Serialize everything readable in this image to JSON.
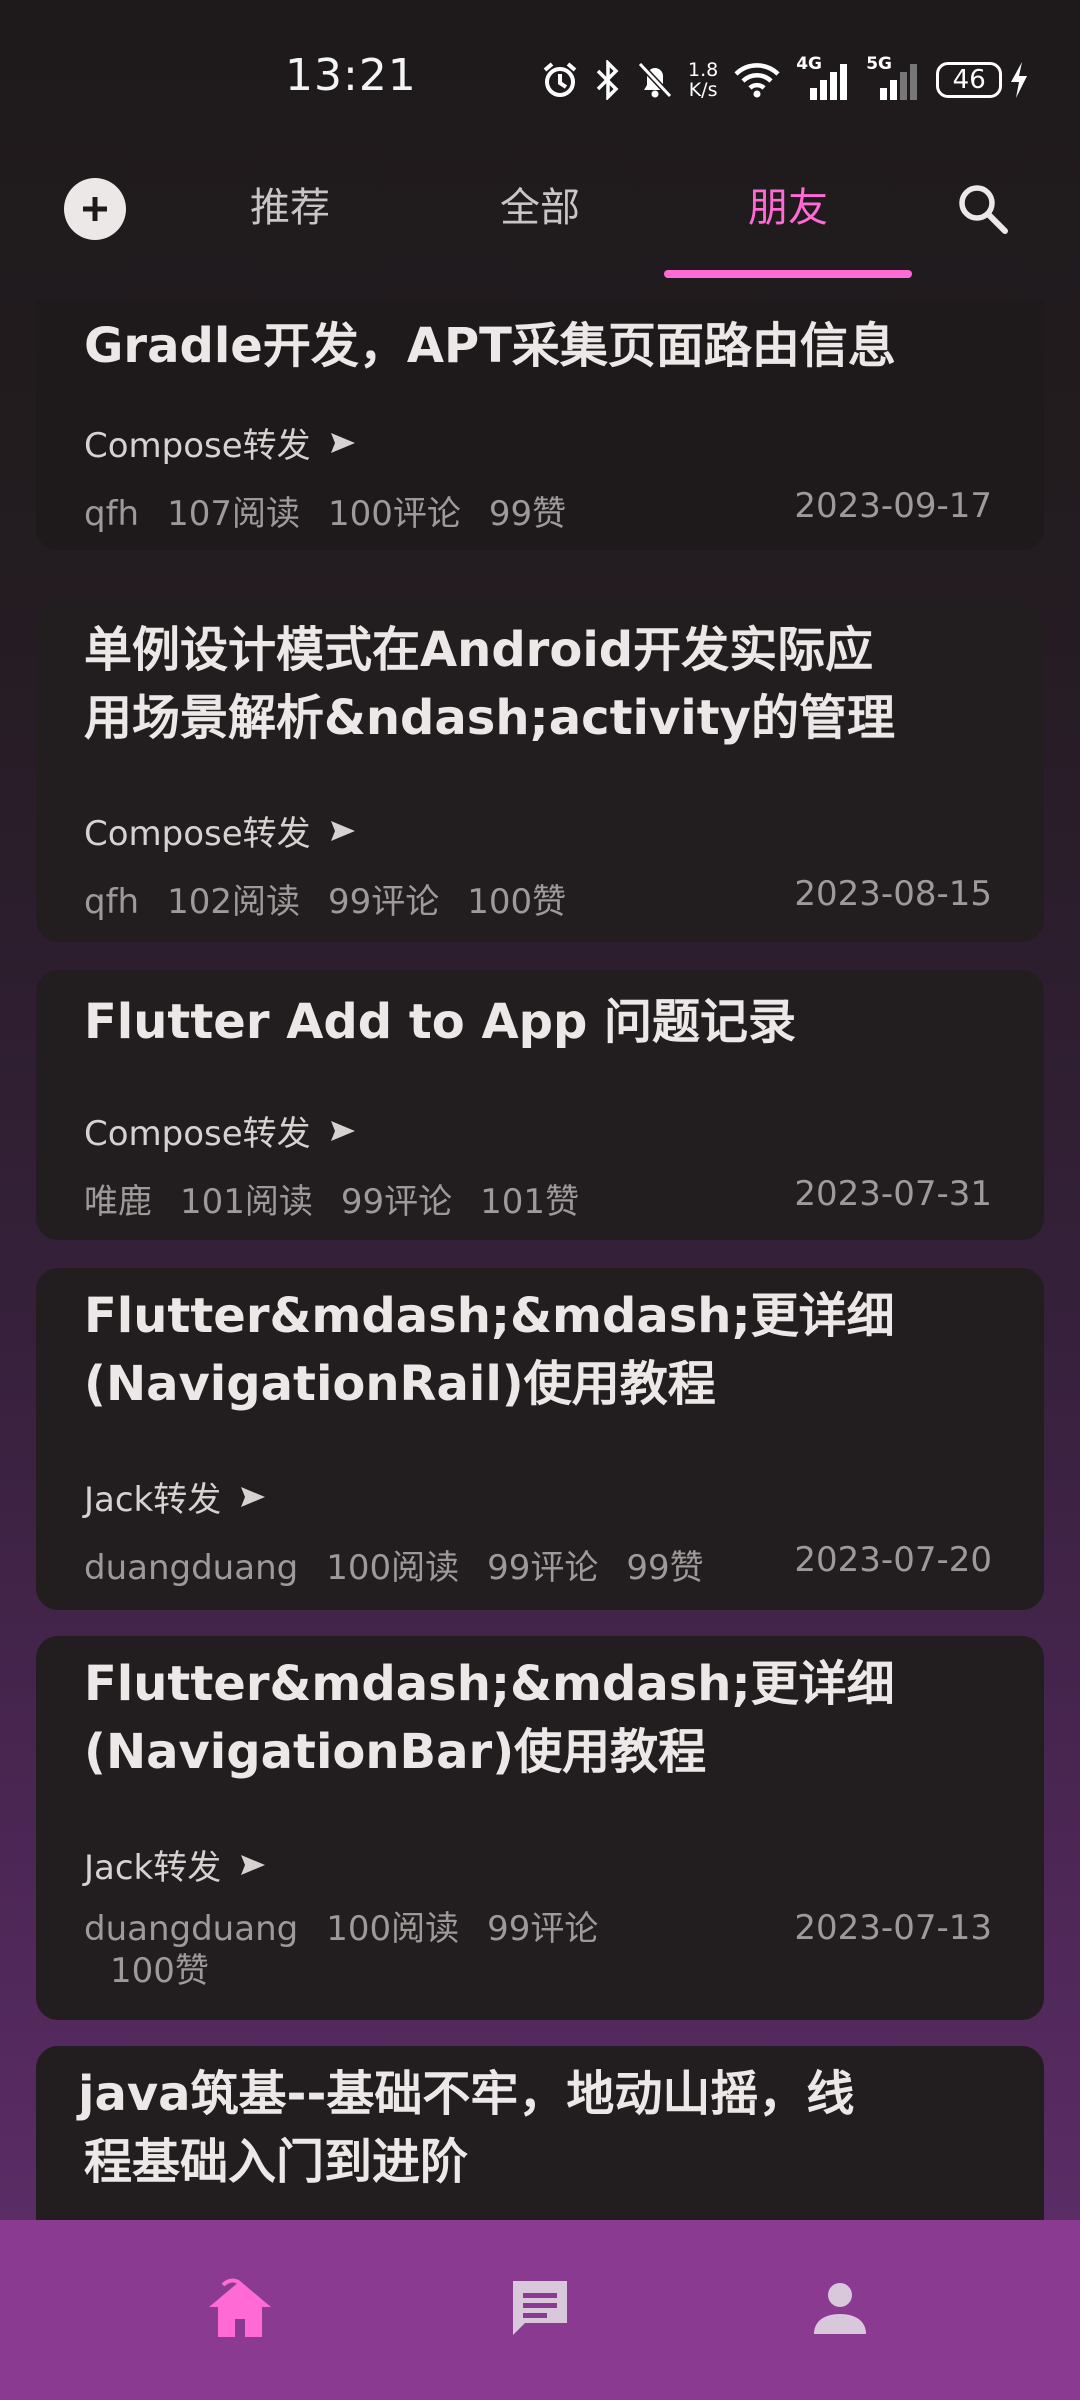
{
  "status": {
    "time": "13:21",
    "speed_value": "1.8",
    "speed_unit": "K/s",
    "net1": "4G",
    "net2": "5G",
    "battery": "46"
  },
  "tabs": {
    "recommend": "推荐",
    "all": "全部",
    "friends": "朋友",
    "active": "朋友"
  },
  "colors": {
    "accent": "#ff6ad5",
    "card": "#221d1e",
    "bottom_nav": "#8a3a90"
  },
  "articles": [
    {
      "title": "Gradle开发，APT采集页面路由信息",
      "forward": "Compose转发",
      "author": "qfh",
      "reads": "107阅读",
      "comments": "100评论",
      "likes": "99赞",
      "date": "2023-09-17"
    },
    {
      "title_line1": "单例设计模式在Android开发实际应",
      "title_line2": "用场景解析&ndash;activity的管理",
      "forward": "Compose转发",
      "author": "qfh",
      "reads": "102阅读",
      "comments": "99评论",
      "likes": "100赞",
      "date": "2023-08-15"
    },
    {
      "title": "Flutter Add to App 问题记录",
      "forward": "Compose转发",
      "author": "唯鹿",
      "reads": "101阅读",
      "comments": "99评论",
      "likes": "101赞",
      "date": "2023-07-31"
    },
    {
      "title_line1": "Flutter&mdash;&mdash;更详细",
      "title_line2": "(NavigationRail)使用教程",
      "forward": "Jack转发",
      "author": "duangduang",
      "reads": "100阅读",
      "comments": "99评论",
      "likes": "99赞",
      "date": "2023-07-20"
    },
    {
      "title_line1": "Flutter&mdash;&mdash;更详细",
      "title_line2": "(NavigationBar)使用教程",
      "forward": "Jack转发",
      "author": "duangduang",
      "reads": "100阅读",
      "comments": "99评论",
      "likes": "100赞",
      "date": "2023-07-13"
    },
    {
      "title_line1": "java筑基--基础不牢，地动山摇，线",
      "title_line2": "程基础入门到进阶"
    }
  ],
  "icons": {
    "add": "add-circle-icon",
    "search": "search-icon",
    "home": "home-icon",
    "messages": "message-icon",
    "profile": "person-icon",
    "forward": "send-arrow-icon"
  }
}
